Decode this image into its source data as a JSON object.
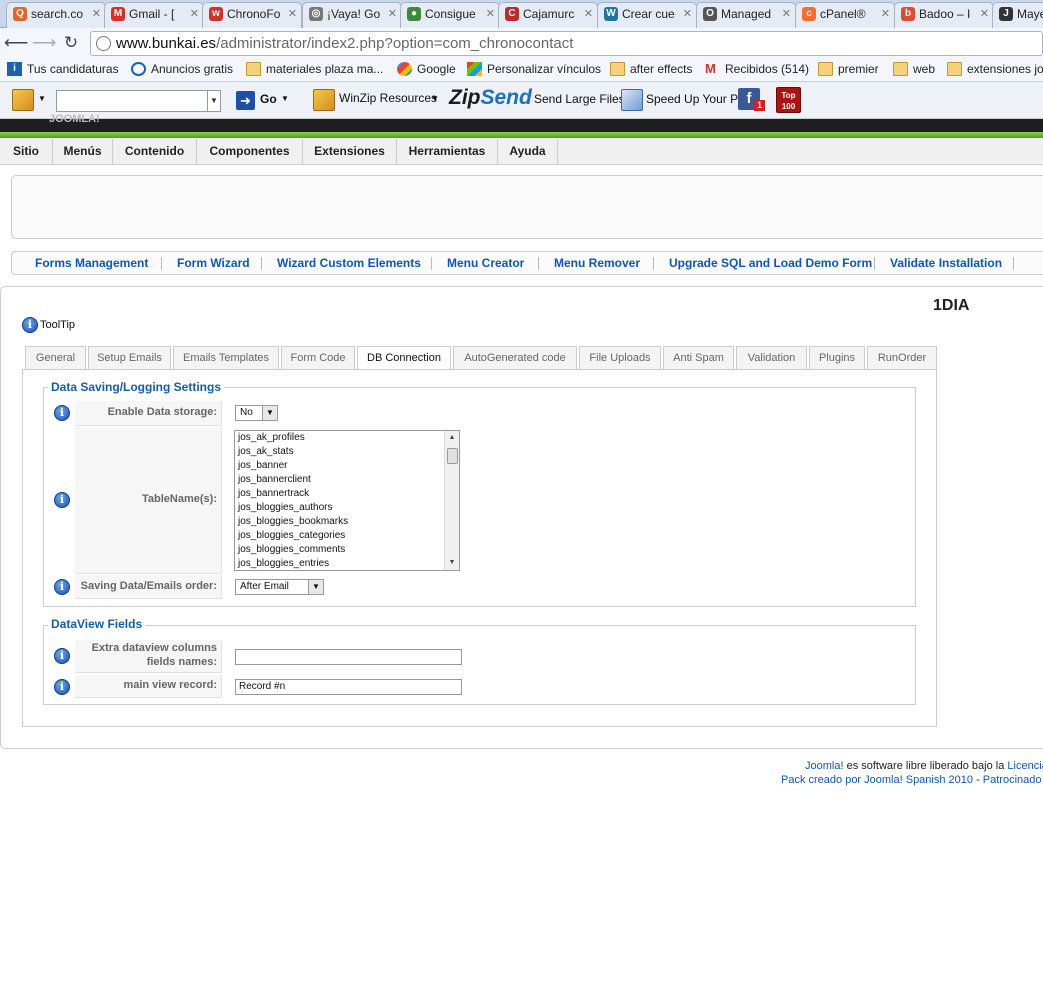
{
  "browser": {
    "tabs": [
      {
        "label": "search.co",
        "icon": "search-favicon",
        "color": "#e2652a"
      },
      {
        "label": "Gmail - [",
        "icon": "gmail-favicon",
        "color": "#d93025"
      },
      {
        "label": "ChronoFo",
        "icon": "chronoforms-favicon",
        "color": "#d3302a"
      },
      {
        "label": "¡Vaya! Go",
        "icon": "globe-favicon",
        "color": "#777777"
      },
      {
        "label": "Consigue",
        "icon": "chrome-favicon",
        "color": "#3c8b3c"
      },
      {
        "label": "Cajamurc",
        "icon": "cajamurcia-favicon",
        "color": "#c0282d"
      },
      {
        "label": "Crear cue",
        "icon": "wordpress-favicon",
        "color": "#21759b"
      },
      {
        "label": "Managed",
        "icon": "managed-favicon",
        "color": "#555555"
      },
      {
        "label": "cPanel®",
        "icon": "cpanel-favicon",
        "color": "#ff6c2c"
      },
      {
        "label": "Badoo – I",
        "icon": "badoo-favicon",
        "color": "#e04a2f"
      },
      {
        "label": "Maye",
        "icon": "joomla-favicon",
        "color": "#333333"
      }
    ],
    "url_host": "www.bunkai.es",
    "url_path": "/administrator/index2.php?option=com_chronocontact",
    "bookmarks": [
      {
        "label": "Tus candidaturas",
        "icon": "infojobs-icon"
      },
      {
        "label": "Anuncios gratis",
        "icon": "anuncios-icon"
      },
      {
        "label": "materiales plaza ma...",
        "icon": "folder-icon"
      },
      {
        "label": "Google",
        "icon": "google-icon"
      },
      {
        "label": "Personalizar vínculos",
        "icon": "windows-icon"
      },
      {
        "label": "after effects",
        "icon": "folder-icon"
      },
      {
        "label": "Recibidos (514)",
        "icon": "gmail-icon"
      },
      {
        "label": "premier",
        "icon": "folder-icon"
      },
      {
        "label": "web",
        "icon": "folder-icon"
      },
      {
        "label": "extensiones joo",
        "icon": "folder-icon"
      }
    ],
    "toolbar": {
      "go_label": "Go",
      "winzip_label": "WinZip Resources",
      "zipsend_zip": "Zip",
      "zipsend_send": "Send",
      "send_files_label": "Send Large Files",
      "speedup_label": "Speed Up Your PC",
      "facebook_badge": "1",
      "top100_label": "Top 100"
    }
  },
  "joomla": {
    "logo_text": "JOOMLA!",
    "menu": [
      "Sitio",
      "Menús",
      "Contenido",
      "Componentes",
      "Extensiones",
      "Herramientas",
      "Ayuda"
    ],
    "submenu": [
      "Forms Management",
      "Form Wizard",
      "Wizard Custom Elements",
      "Menu Creator",
      "Menu Remover",
      "Upgrade SQL and Load Demo Form",
      "Validate Installation"
    ],
    "form_title": "1DIA",
    "tooltip_label": "ToolTip",
    "tabs": [
      "General",
      "Setup Emails",
      "Emails Templates",
      "Form Code",
      "DB Connection",
      "AutoGenerated code",
      "File Uploads",
      "Anti Spam",
      "Validation",
      "Plugins",
      "RunOrder"
    ],
    "active_tab": "DB Connection",
    "data_saving": {
      "legend": "Data Saving/Logging Settings",
      "enable_label": "Enable Data storage:",
      "enable_value": "No",
      "tables_label": "TableName(s):",
      "tables": [
        "jos_ak_profiles",
        "jos_ak_stats",
        "jos_banner",
        "jos_bannerclient",
        "jos_bannertrack",
        "jos_bloggies_authors",
        "jos_bloggies_bookmarks",
        "jos_bloggies_categories",
        "jos_bloggies_comments",
        "jos_bloggies_entries"
      ],
      "order_label": "Saving Data/Emails order:",
      "order_value": "After Email"
    },
    "dataview": {
      "legend": "DataView Fields",
      "extra_label_1": "Extra dataview columns",
      "extra_label_2": "fields names:",
      "extra_value": "",
      "main_label": "main view record:",
      "main_value": "Record #n"
    }
  },
  "footer": {
    "line1_link": "Joomla!",
    "line1_text": " es software libre liberado bajo la ",
    "line1_link2": "Licencia",
    "line2_text": "Pack creado por Joomla! Spanish 2010",
    "line2_sep": " - ",
    "line2_link": "Patrocinado p"
  }
}
